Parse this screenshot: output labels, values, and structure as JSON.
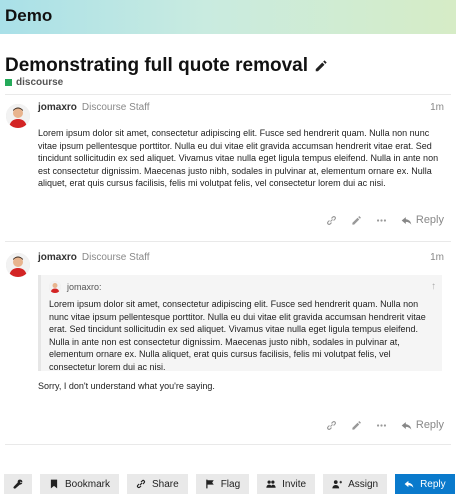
{
  "site": {
    "title": "Demo"
  },
  "topic": {
    "title": "Demonstrating full quote removal",
    "category": "discourse",
    "category_color": "#25aa5a"
  },
  "posts": [
    {
      "username": "jomaxro",
      "user_title": "Discourse Staff",
      "age": "1m",
      "text": "Lorem ipsum dolor sit amet, consectetur adipiscing elit. Fusce sed hendrerit quam. Nulla non nunc vitae ipsum pellentesque porttitor. Nulla eu dui vitae elit gravida accumsan hendrerit vitae erat. Sed tincidunt sollicitudin ex sed aliquet. Vivamus vitae nulla eget ligula tempus eleifend. Nulla in ante non est consectetur dignissim. Maecenas justo nibh, sodales in pulvinar at, elementum ornare ex. Nulla aliquet, erat quis cursus facilisis, felis mi volutpat felis, vel consectetur lorem dui ac nisi.",
      "reply_label": "Reply"
    },
    {
      "username": "jomaxro",
      "user_title": "Discourse Staff",
      "age": "1m",
      "quote_author": "jomaxro:",
      "quote_text": "Lorem ipsum dolor sit amet, consectetur adipiscing elit. Fusce sed hendrerit quam. Nulla non nunc vitae ipsum pellentesque porttitor. Nulla eu dui vitae elit gravida accumsan hendrerit vitae erat. Sed tincidunt sollicitudin ex sed aliquet. Vivamus vitae nulla eget ligula tempus eleifend. Nulla in ante non est consectetur dignissim. Maecenas justo nibh, sodales in pulvinar at, elementum ornare ex. Nulla aliquet, erat quis cursus facilisis, felis mi volutpat felis, vel consectetur lorem dui ac nisi.",
      "text": "Sorry, I don't understand what you're saying.",
      "reply_label": "Reply"
    }
  ],
  "footer": {
    "bookmark": "Bookmark",
    "share": "Share",
    "flag": "Flag",
    "invite": "Invite",
    "assign": "Assign",
    "reply": "Reply"
  },
  "icons": {
    "header": "none",
    "title": "pencil-icon",
    "post_actions": [
      "link-icon",
      "pencil-icon",
      "ellipsis-icon",
      "reply-icon"
    ],
    "footer": [
      "wrench-icon",
      "bookmark-icon",
      "link-icon",
      "flag-icon",
      "users-icon",
      "user-plus-icon",
      "reply-icon"
    ]
  },
  "colors": {
    "primary": "#0a7acc",
    "header_gradient_start": "#a9e0e8",
    "header_gradient_end": "#d6ecc6"
  }
}
